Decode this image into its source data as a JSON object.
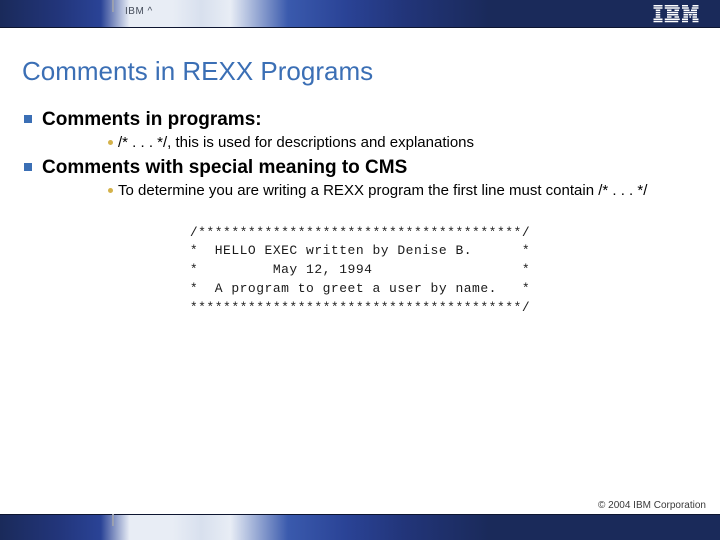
{
  "header": {
    "brand": "IBM ^",
    "logo_alt": "IBM"
  },
  "title": "Comments in REXX Programs",
  "bullets": [
    {
      "text": "Comments in programs:",
      "sub": "/* . . . */, this is used for descriptions and explanations"
    },
    {
      "text": "Comments with special meaning to CMS",
      "sub": "To determine you are writing a REXX program the first line must contain /* . . . */"
    }
  ],
  "code": "/***************************************/\n*  HELLO EXEC written by Denise B.      *\n*         May 12, 1994                  *\n*  A program to greet a user by name.   *\n****************************************/",
  "footer": {
    "copyright": "© 2004 IBM Corporation"
  }
}
